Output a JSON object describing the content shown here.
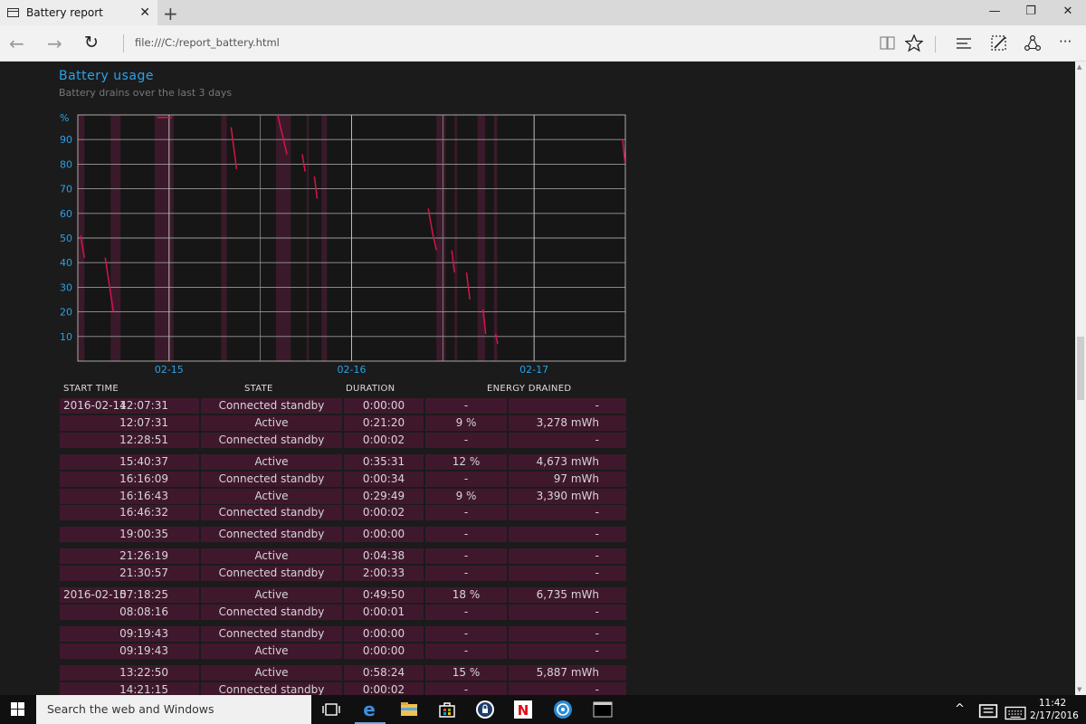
{
  "browser": {
    "tab_title": "Battery report",
    "tab_close": "✕",
    "new_tab": "+",
    "address": "file:///C:/report_battery.html",
    "back": "←",
    "forward": "→",
    "refresh": "↻",
    "minimize": "—",
    "restore": "❐",
    "close": "✕",
    "more": "···"
  },
  "report": {
    "title": "Battery usage",
    "subtitle": "Battery drains over the last 3 days"
  },
  "chart_data": {
    "type": "line",
    "ylabel": "%",
    "ylim": [
      0,
      100
    ],
    "yticks": [
      90,
      80,
      70,
      60,
      50,
      40,
      30,
      20,
      10
    ],
    "xticks": [
      "02-15",
      "02-16",
      "02-17"
    ],
    "x_range_days": [
      "02-14",
      "02-17"
    ],
    "series": [
      {
        "segments": [
          [
            [
              0.005,
              51
            ],
            [
              0.012,
              42
            ]
          ],
          [
            [
              0.05,
              42
            ],
            [
              0.065,
              20
            ]
          ],
          [
            [
              0.28,
              95
            ],
            [
              0.29,
              78
            ]
          ],
          [
            [
              0.365,
              100
            ],
            [
              0.382,
              84
            ]
          ],
          [
            [
              0.41,
              84
            ],
            [
              0.415,
              77
            ]
          ],
          [
            [
              0.432,
              75
            ],
            [
              0.437,
              66
            ]
          ],
          [
            [
              0.64,
              62
            ],
            [
              0.648,
              52
            ],
            [
              0.655,
              45
            ]
          ],
          [
            [
              0.683,
              45
            ],
            [
              0.688,
              36
            ]
          ],
          [
            [
              0.71,
              36
            ],
            [
              0.716,
              25
            ]
          ],
          [
            [
              0.74,
              21
            ],
            [
              0.745,
              11
            ]
          ],
          [
            [
              0.763,
              11
            ],
            [
              0.767,
              7
            ]
          ],
          [
            [
              0.995,
              90
            ],
            [
              0.999,
              81
            ]
          ]
        ]
      },
      {
        "segments": [
          [
            [
              0.145,
              99
            ],
            [
              0.172,
              99
            ]
          ]
        ]
      }
    ],
    "connected_standby_bands": [
      [
        0.0,
        0.012
      ],
      [
        0.06,
        0.078
      ],
      [
        0.14,
        0.175
      ],
      [
        0.262,
        0.272
      ],
      [
        0.362,
        0.389
      ],
      [
        0.418,
        0.422
      ],
      [
        0.445,
        0.455
      ],
      [
        0.655,
        0.672
      ],
      [
        0.688,
        0.693
      ],
      [
        0.73,
        0.744
      ],
      [
        0.76,
        0.766
      ]
    ]
  },
  "table": {
    "headers": {
      "start": "START TIME",
      "state": "STATE",
      "duration": "DURATION",
      "energy": "ENERGY DRAINED"
    },
    "rows": [
      {
        "date": "2016-02-14",
        "time": "12:07:31",
        "state": "Connected standby",
        "duration": "0:00:00",
        "pct": "-",
        "mwh": "-"
      },
      {
        "time": "12:07:31",
        "state": "Active",
        "duration": "0:21:20",
        "pct": "9 %",
        "mwh": "3,278 mWh"
      },
      {
        "time": "12:28:51",
        "state": "Connected standby",
        "duration": "0:00:02",
        "pct": "-",
        "mwh": "-"
      },
      {
        "time": "15:40:37",
        "state": "Active",
        "duration": "0:35:31",
        "pct": "12 %",
        "mwh": "4,673 mWh"
      },
      {
        "time": "16:16:09",
        "state": "Connected standby",
        "duration": "0:00:34",
        "pct": "-",
        "mwh": "97 mWh"
      },
      {
        "time": "16:16:43",
        "state": "Active",
        "duration": "0:29:49",
        "pct": "9 %",
        "mwh": "3,390 mWh"
      },
      {
        "time": "16:46:32",
        "state": "Connected standby",
        "duration": "0:00:02",
        "pct": "-",
        "mwh": "-"
      },
      {
        "time": "19:00:35",
        "state": "Connected standby",
        "duration": "0:00:00",
        "pct": "-",
        "mwh": "-"
      },
      {
        "time": "21:26:19",
        "state": "Active",
        "duration": "0:04:38",
        "pct": "-",
        "mwh": "-"
      },
      {
        "time": "21:30:57",
        "state": "Connected standby",
        "duration": "2:00:33",
        "pct": "-",
        "mwh": "-"
      },
      {
        "date": "2016-02-15",
        "time": "07:18:25",
        "state": "Active",
        "duration": "0:49:50",
        "pct": "18 %",
        "mwh": "6,735 mWh"
      },
      {
        "time": "08:08:16",
        "state": "Connected standby",
        "duration": "0:00:01",
        "pct": "-",
        "mwh": "-"
      },
      {
        "time": "09:19:43",
        "state": "Connected standby",
        "duration": "0:00:00",
        "pct": "-",
        "mwh": "-"
      },
      {
        "time": "09:19:43",
        "state": "Active",
        "duration": "0:00:00",
        "pct": "-",
        "mwh": "-"
      },
      {
        "time": "13:22:50",
        "state": "Active",
        "duration": "0:58:24",
        "pct": "15 %",
        "mwh": "5,887 mWh"
      },
      {
        "time": "14:21:15",
        "state": "Connected standby",
        "duration": "0:00:02",
        "pct": "-",
        "mwh": "-"
      }
    ]
  },
  "taskbar": {
    "search_placeholder": "Search the web and Windows",
    "time": "11:42",
    "date": "2/17/2016"
  },
  "colors": {
    "accent": "#2aa2e8",
    "line": "#d4144a",
    "band": "#3a1a2a",
    "row": "#40182e"
  }
}
